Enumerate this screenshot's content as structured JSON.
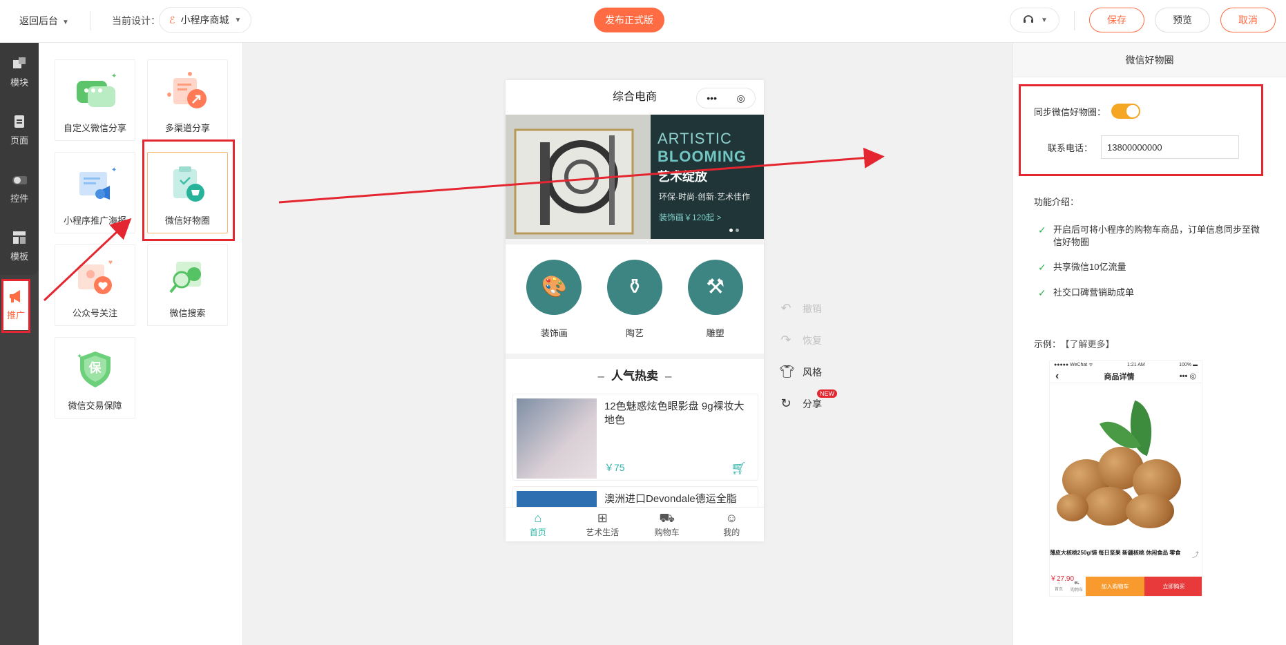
{
  "topbar": {
    "back_label": "返回后台",
    "current_design_label": "当前设计：",
    "design_name": "小程序商城",
    "publish_label": "发布正式版",
    "save_label": "保存",
    "preview_label": "预览",
    "cancel_label": "取消"
  },
  "rail": {
    "items": [
      {
        "label": "模块",
        "icon": "module-icon"
      },
      {
        "label": "页面",
        "icon": "page-icon"
      },
      {
        "label": "控件",
        "icon": "toggle-icon"
      },
      {
        "label": "模板",
        "icon": "template-icon"
      },
      {
        "label": "推广",
        "icon": "megaphone-icon"
      }
    ],
    "active": "推广"
  },
  "palette": {
    "tiles": [
      {
        "label": "自定义微信分享",
        "icon": "wechat-share-icon"
      },
      {
        "label": "多渠道分享",
        "icon": "multi-share-icon"
      },
      {
        "label": "小程序推广海报",
        "icon": "poster-icon"
      },
      {
        "label": "微信好物圈",
        "icon": "goods-circle-icon"
      },
      {
        "label": "公众号关注",
        "icon": "follow-icon"
      },
      {
        "label": "微信搜索",
        "icon": "wechat-search-icon"
      },
      {
        "label": "微信交易保障",
        "icon": "trade-guarantee-icon"
      }
    ],
    "selected": "微信好物圈",
    "guarantee_char": "保"
  },
  "phone": {
    "title": "综合电商",
    "capsule_more": "•••",
    "banner": {
      "line1": "ARTISTIC",
      "line2": "BLOOMING",
      "line3": "艺术绽放",
      "line4": "环保·时尚·创新·艺术佳作",
      "line5": "装饰画￥120起 >"
    },
    "categories": [
      {
        "label": "装饰画",
        "icon": "palette-icon"
      },
      {
        "label": "陶艺",
        "icon": "vase-icon"
      },
      {
        "label": "雕塑",
        "icon": "tools-icon"
      }
    ],
    "hot_title": "人气热卖",
    "hot_dash": "–",
    "products": [
      {
        "title": "12色魅惑炫色眼影盘 9g裸妆大地色",
        "price": "￥75"
      },
      {
        "title": "澳洲进口Devondale德运全脂"
      }
    ],
    "tabs": [
      {
        "label": "首页",
        "icon": "home-icon"
      },
      {
        "label": "艺术生活",
        "icon": "grid-icon"
      },
      {
        "label": "购物车",
        "icon": "cart-icon"
      },
      {
        "label": "我的",
        "icon": "user-icon"
      }
    ]
  },
  "tools": {
    "undo": "撤销",
    "redo": "恢复",
    "style": "风格",
    "share": "分享",
    "new_badge": "NEW"
  },
  "settings": {
    "title": "微信好物圈",
    "sync_label": "同步微信好物圈：",
    "sync_on": true,
    "phone_label": "联系电话：",
    "phone_value": "13800000000",
    "intro_label": "功能介绍：",
    "features": [
      "开启后可将小程序的购物车商品，订单信息同步至微信好物圈",
      "共享微信10亿流量",
      "社交口碑营销助成单"
    ],
    "example_label": "示例：",
    "learn_more": "【了解更多】"
  },
  "mock": {
    "status_left": "●●●●● WeChat ᯤ",
    "status_time": "1:21 AM",
    "status_right": "100% ▬",
    "nav_back": "‹",
    "nav_title": "商品详情",
    "nav_more": "•••",
    "product_name": "薄皮大核桃250g/袋 每日坚果 新疆核桃 休闲食品 零食",
    "price": "￥27.90",
    "home": "首页",
    "cart": "购物车",
    "add_cart": "加入购物车",
    "buy_now": "立即购买"
  },
  "colors": {
    "accent": "#ff6b42",
    "teal": "#2fb5a8",
    "highlight_red": "#e42630",
    "toggle_on": "#f5a623"
  }
}
